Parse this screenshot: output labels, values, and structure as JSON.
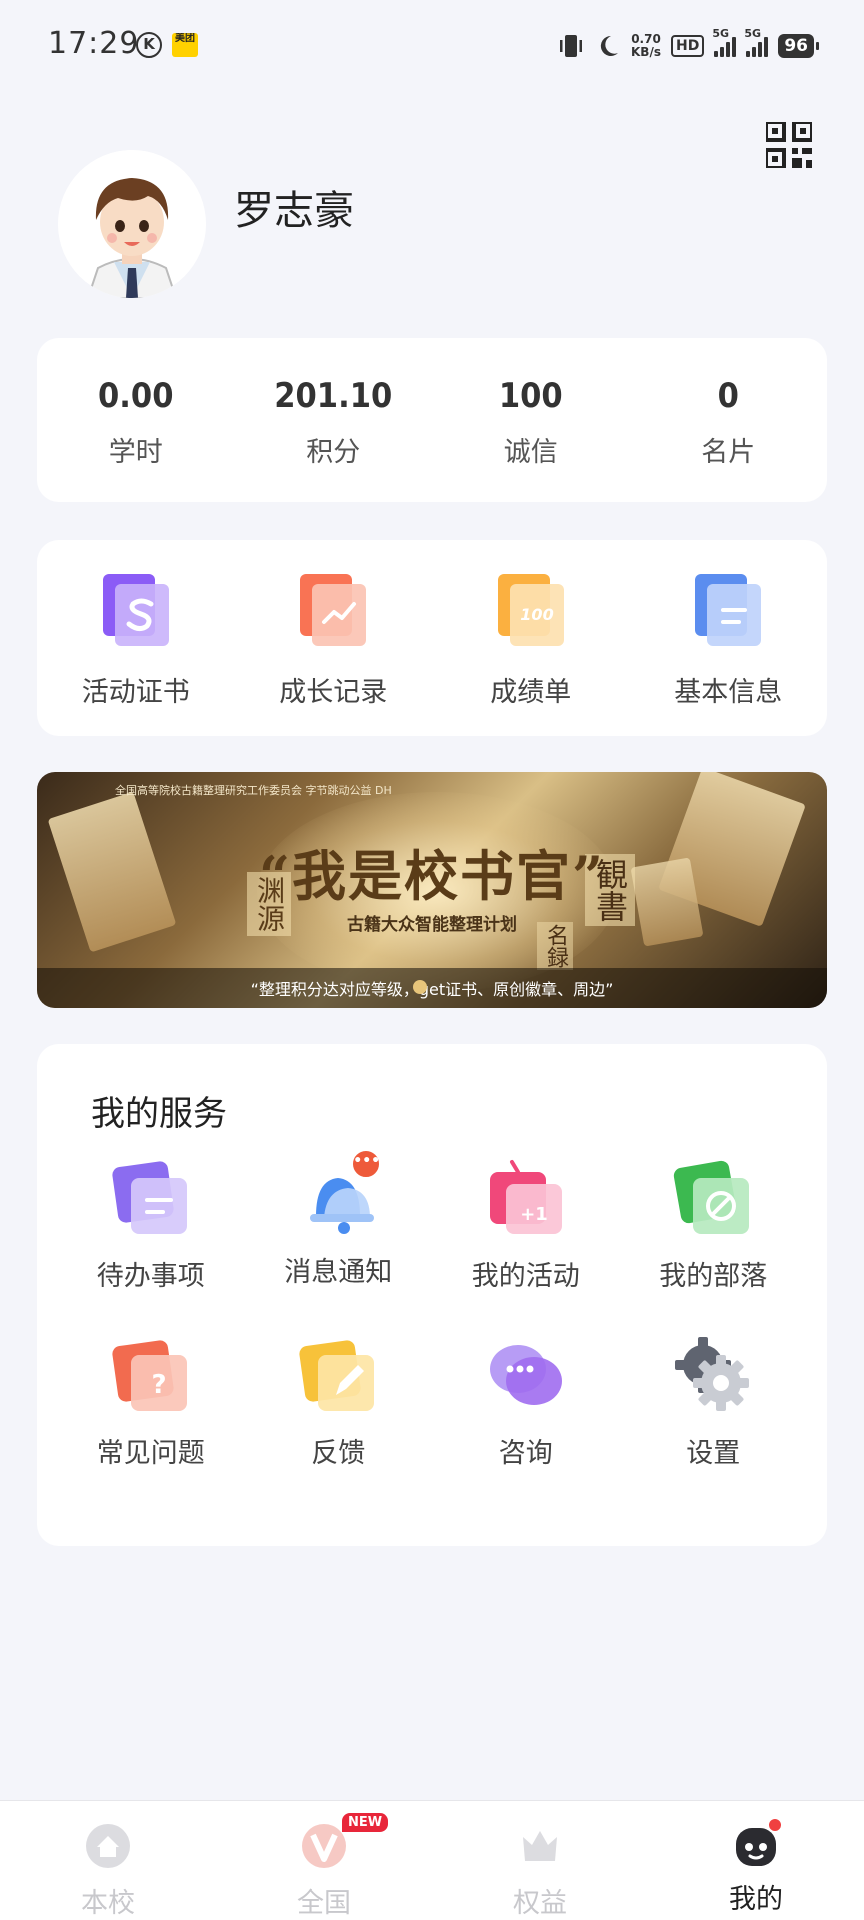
{
  "status_bar": {
    "time": "17:29",
    "k_icon": "K",
    "app_badge": "美团",
    "speed_value": "0.70",
    "speed_unit": "KB/s",
    "hd": "HD",
    "sim1": "5G",
    "sim2": "5G",
    "battery": "96"
  },
  "profile": {
    "name": "罗志豪"
  },
  "stats": [
    {
      "value": "0.00",
      "label": "学时"
    },
    {
      "value": "201.10",
      "label": "积分"
    },
    {
      "value": "100",
      "label": "诚信"
    },
    {
      "value": "0",
      "label": "名片"
    }
  ],
  "quick_entries": [
    {
      "label": "活动证书",
      "icon": "certificate-icon",
      "color": "#8b5cf6"
    },
    {
      "label": "成长记录",
      "icon": "growth-chart-icon",
      "color": "#f97354"
    },
    {
      "label": "成绩单",
      "icon": "score-100-icon",
      "color": "#fbb040"
    },
    {
      "label": "基本信息",
      "icon": "info-doc-icon",
      "color": "#5b8def"
    }
  ],
  "banner": {
    "logos": "全国高等院校古籍整理研究工作委员会  字节跳动公益  DH",
    "title": "“我是校书官”",
    "subtitle": "古籍大众智能整理计划",
    "side_left": "渊源",
    "side_right": "観書",
    "side_mid": "名録",
    "caption": "“整理积分达对应等级，get证书、原创徽章、周边”"
  },
  "services": {
    "title": "我的服务",
    "items": [
      {
        "label": "待办事项",
        "icon": "todo-icon",
        "color": "#8b6cf0"
      },
      {
        "label": "消息通知",
        "icon": "bell-icon",
        "color": "#4a8df0",
        "badge": "•••"
      },
      {
        "label": "我的活动",
        "icon": "activity-icon",
        "color": "#f0487a"
      },
      {
        "label": "我的部落",
        "icon": "tribe-icon",
        "color": "#3cb950"
      },
      {
        "label": "常见问题",
        "icon": "faq-icon",
        "color": "#f26b4f"
      },
      {
        "label": "反馈",
        "icon": "feedback-icon",
        "color": "#f7c23a"
      },
      {
        "label": "咨询",
        "icon": "consult-chat-icon",
        "color": "#a06df0"
      },
      {
        "label": "设置",
        "icon": "gear-icon",
        "color": "#7a7f8a"
      }
    ]
  },
  "tabbar": {
    "items": [
      {
        "label": "本校",
        "icon": "home-icon"
      },
      {
        "label": "全国",
        "icon": "nation-v-icon",
        "badge": "NEW"
      },
      {
        "label": "权益",
        "icon": "crown-icon"
      },
      {
        "label": "我的",
        "icon": "profile-face-icon",
        "active": true
      }
    ]
  }
}
